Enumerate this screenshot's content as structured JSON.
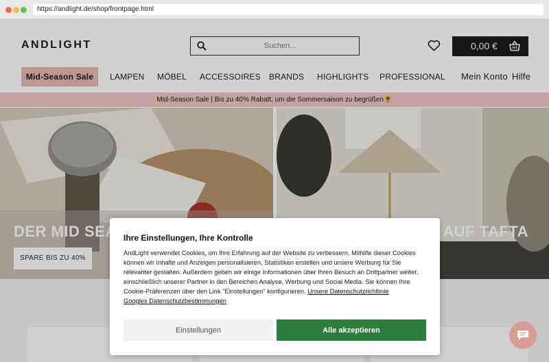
{
  "browser": {
    "url": "https://andlight.de/shop/frontpage.html"
  },
  "header": {
    "logo": "ANDLIGHT",
    "search_placeholder": "Suchen...",
    "cart_total": "0,00 €"
  },
  "nav": {
    "items": [
      "Mid-Season Sale",
      "LAMPEN",
      "MÖBEL",
      "ACCESSOIRES",
      "BRANDS",
      "HIGHLIGHTS",
      "PROFESSIONAL"
    ],
    "account": "Mein Konto",
    "help": "Hilfe"
  },
  "promo": {
    "text": "Mid-Season Sale | Bis zu 40% Rabatt, um die Sommersaison zu begrüßen🌻"
  },
  "hero": {
    "left_title": "DER MID SEA",
    "left_button": "SPARE BIS ZU 40%",
    "right_title": "E AUF TAFTA"
  },
  "cookie_modal": {
    "title": "Ihre Einstellungen, Ihre Kontrolle",
    "body": "AndLight verwendet Cookies, um Ihre Erfahrung auf der Website zu verbessern. Mithilfe dieser Cookies können wir Inhalte und Anzeigen personalisieren, Statistiken erstellen und unsere Werbung für Sie relevanter gestalten. Außerdem geben wir einige Informationen über Ihren Besuch an Drittpartner weiter, einschließlich unserer Partner in den Bereichen Analyse, Werbung und Social Media. Sie können Ihre Cookie-Präferenzen über den Link \"Einstellungen\" konfigurieren.",
    "link_privacy": "Unsere Datenschutzrichtlinie",
    "link_google": "Googles Datenschutzbestimmungen",
    "settings_label": "Einstellungen",
    "accept_label": "Alle akzeptieren"
  },
  "colors": {
    "sale_pink": "#e8b7b0",
    "accept_green": "#2d7d3e",
    "chat_bubble": "#d89d92"
  }
}
